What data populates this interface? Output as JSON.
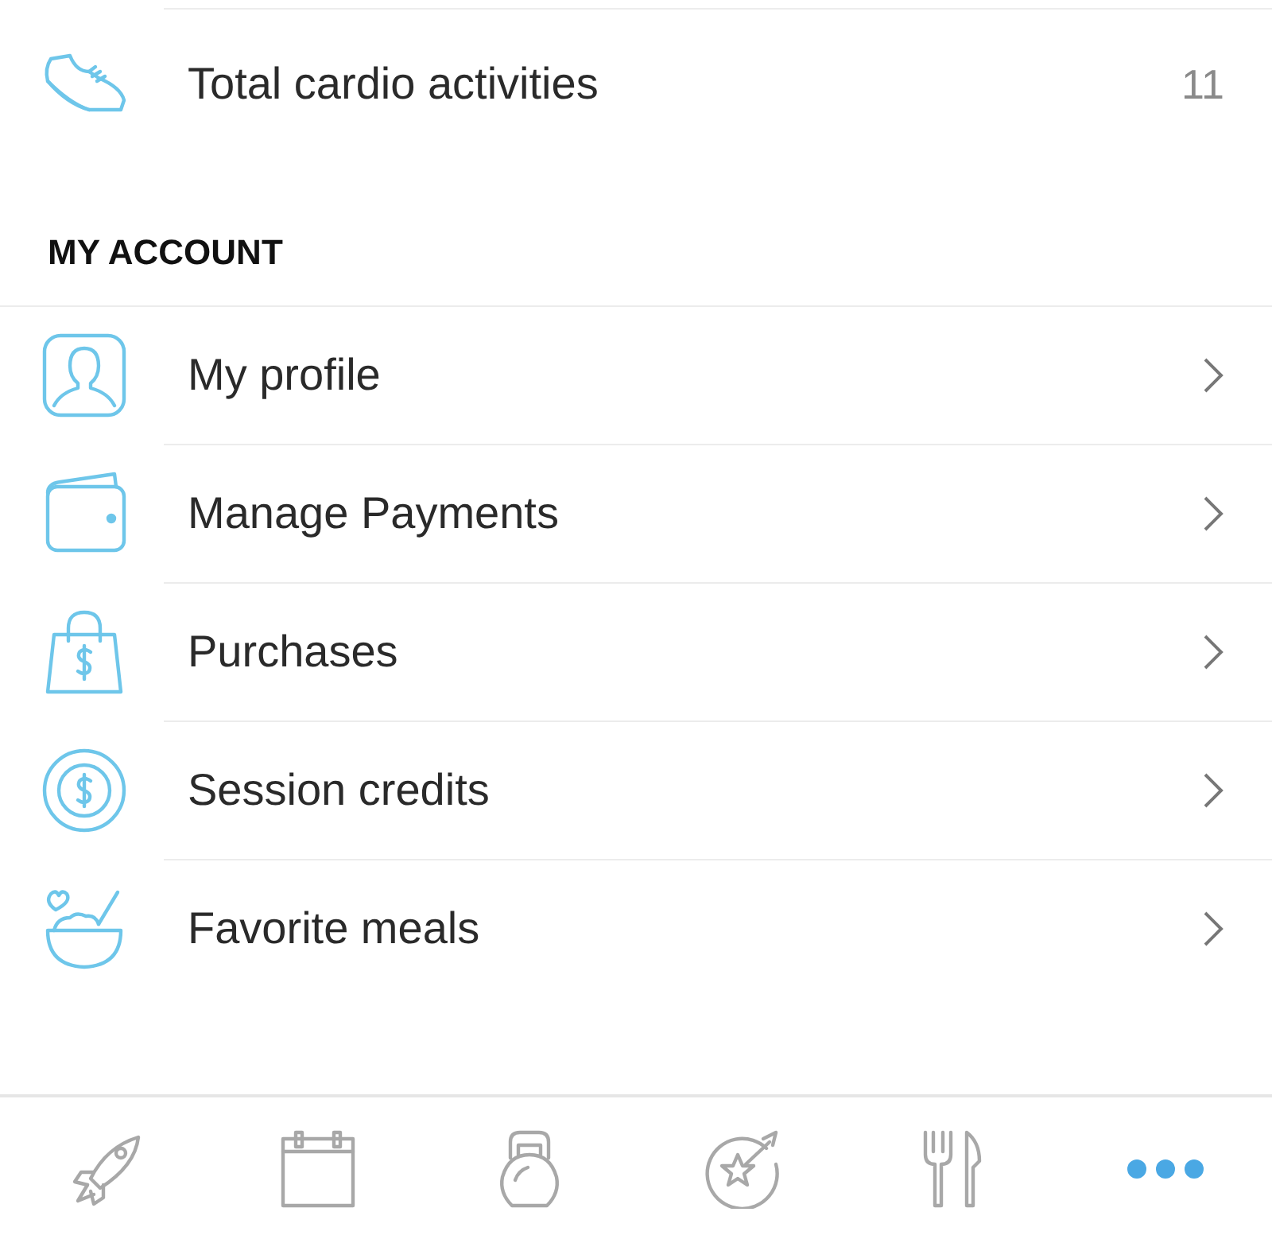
{
  "stats": [
    {
      "kind": "shoe",
      "label": "Total cardio activities",
      "value": "11"
    }
  ],
  "sections": [
    {
      "title": "MY ACCOUNT",
      "items": [
        {
          "kind": "profile",
          "label": "My profile"
        },
        {
          "kind": "wallet",
          "label": "Manage Payments"
        },
        {
          "kind": "bag",
          "label": "Purchases"
        },
        {
          "kind": "coin",
          "label": "Session credits"
        },
        {
          "kind": "bowl",
          "label": "Favorite meals"
        }
      ]
    }
  ],
  "tabs": [
    {
      "kind": "rocket",
      "selected": false
    },
    {
      "kind": "calendar",
      "selected": false
    },
    {
      "kind": "kettlebell",
      "selected": false
    },
    {
      "kind": "badge",
      "selected": false
    },
    {
      "kind": "utensils",
      "selected": false
    },
    {
      "kind": "more",
      "selected": true
    }
  ]
}
